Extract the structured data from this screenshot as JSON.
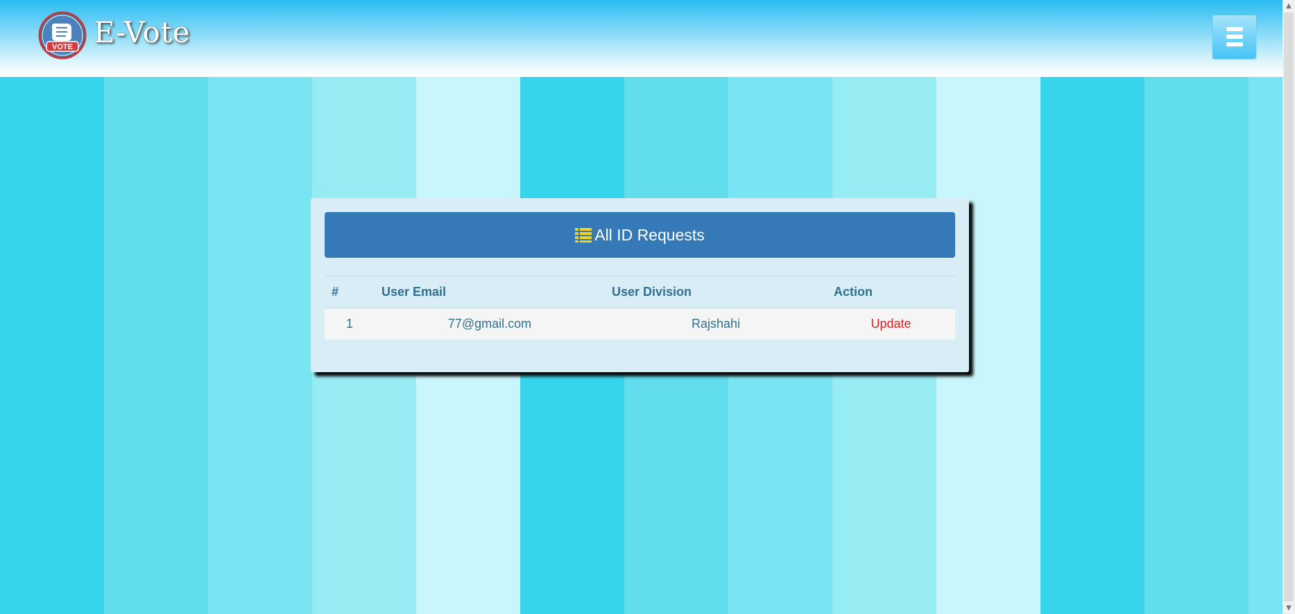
{
  "header": {
    "brand": "E-Vote",
    "logo_icon": "vote-logo-icon",
    "logo_text": "VOTE",
    "menu_icon": "hamburger-menu-icon"
  },
  "panel": {
    "title": "All ID Requests",
    "title_icon": "list-icon",
    "title_icon_color": "#f2d21b",
    "title_bg": "#357ab7",
    "columns": [
      "#",
      "User Email",
      "User Division",
      "Action"
    ],
    "rows": [
      {
        "num": "1",
        "email": "77@gmail.com",
        "division": "Rajshahi",
        "action": "Update"
      }
    ],
    "action_color": "#e02020"
  }
}
